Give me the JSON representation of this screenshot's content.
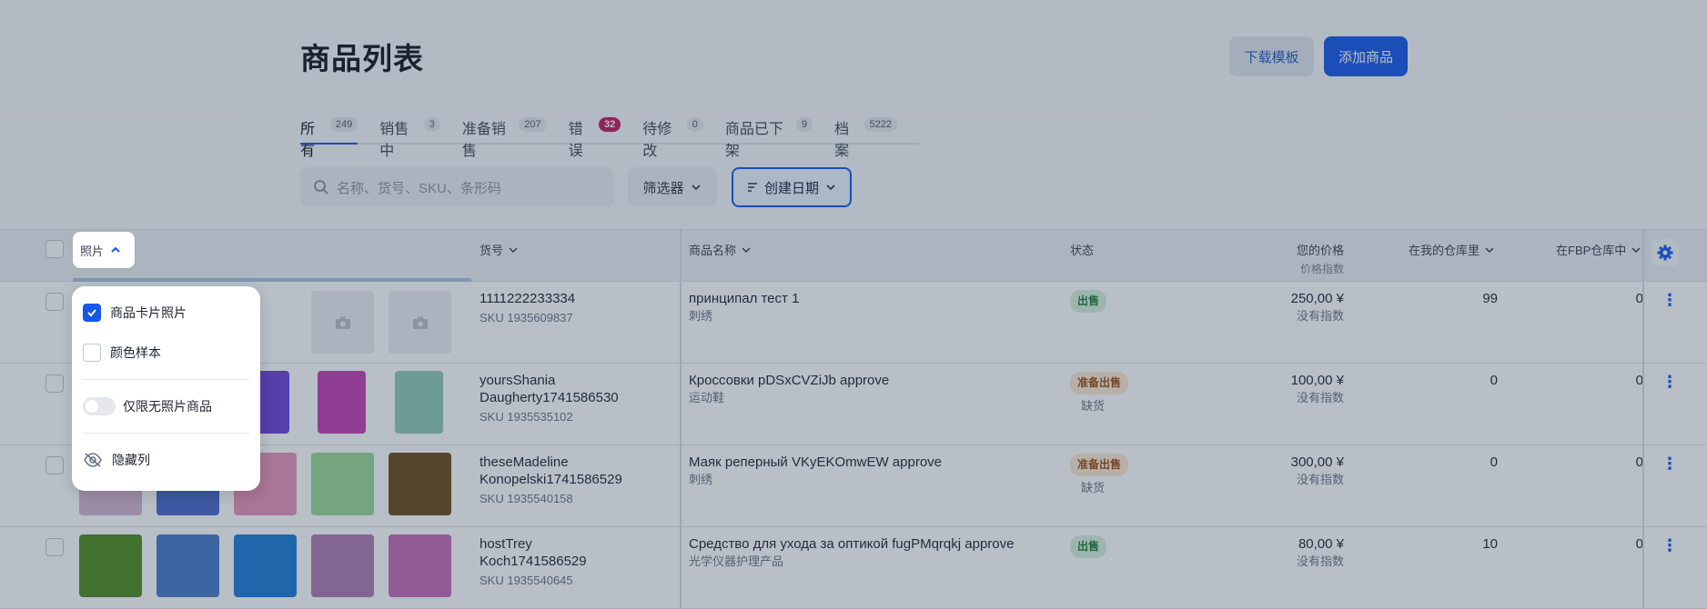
{
  "header": {
    "title": "商品列表",
    "download_template": "下载模板",
    "add_product": "添加商品"
  },
  "tabs": [
    {
      "label": "所有",
      "count": "249"
    },
    {
      "label": "销售中",
      "count": "3"
    },
    {
      "label": "准备销售",
      "count": "207"
    },
    {
      "label": "错误",
      "count": "32"
    },
    {
      "label": "待修改",
      "count": "0"
    },
    {
      "label": "商品已下架",
      "count": "9"
    },
    {
      "label": "档案",
      "count": "5222"
    }
  ],
  "toolbar": {
    "search_placeholder": "名称、货号、SKU、条形码",
    "filters_label": "筛选器",
    "sort_label": "创建日期"
  },
  "columns": {
    "photo": "照片",
    "article": "货号",
    "name": "商品名称",
    "status": "状态",
    "price": "您的价格",
    "price_sub": "价格指数",
    "my_warehouse": "在我的仓库里",
    "fbp_warehouse": "在FBP仓库中"
  },
  "rows": [
    {
      "article_line1": "1111222233334",
      "article_line2": "",
      "sku": "SKU 1935609837",
      "name": "принципал тест 1",
      "category": "刺绣",
      "status": "出售",
      "status_note": "",
      "price": "250,00 ¥",
      "price_index": "没有指数",
      "my_stock": "99",
      "fbp_stock": "0"
    },
    {
      "article_line1": "yoursShania",
      "article_line2": "Daugherty1741586530",
      "sku": "SKU 1935535102",
      "name": "Кроссовки pDSxCVZiJb approve",
      "category": "运动鞋",
      "status": "准备出售",
      "status_note": "缺货",
      "price": "100,00 ¥",
      "price_index": "没有指数",
      "my_stock": "0",
      "fbp_stock": "0"
    },
    {
      "article_line1": "theseMadeline",
      "article_line2": "Konopelski1741586529",
      "sku": "SKU 1935540158",
      "name": "Маяк реперный VKyEKOmwEW approve",
      "category": "刺绣",
      "status": "准备出售",
      "status_note": "缺货",
      "price": "300,00 ¥",
      "price_index": "没有指数",
      "my_stock": "0",
      "fbp_stock": "0"
    },
    {
      "article_line1": "hostTrey",
      "article_line2": "Koch1741586529",
      "sku": "SKU 1935540645",
      "name": "Средство для ухода за оптикой fugPMqrqkj approve",
      "category": "光学仪器护理产品",
      "status": "出售",
      "status_note": "",
      "price": "80,00 ¥",
      "price_index": "没有指数",
      "my_stock": "10",
      "fbp_stock": "0"
    }
  ],
  "thumb_colors": {
    "row2": [
      "#6d3fd8",
      "#c23fb4",
      "#93c9b8"
    ],
    "row3": [
      "#d7b3cf",
      "#4a68c8",
      "#e793b7",
      "#9bd892",
      "#6b4c1a"
    ],
    "row4": [
      "#4f8b1e",
      "#4679c6",
      "#1e7ad6",
      "#b07ab2",
      "#c56ab8"
    ]
  },
  "popup": {
    "opt_card_photo": "商品卡片照片",
    "opt_color_sample": "颜色样本",
    "opt_no_photo_only": "仅限无照片商品",
    "opt_hide_column": "隐藏列"
  }
}
